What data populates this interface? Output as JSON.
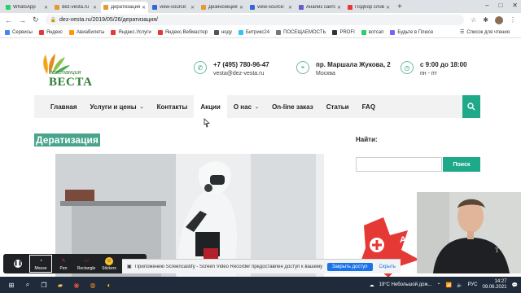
{
  "browser": {
    "tabs": [
      {
        "label": "WhatsApp",
        "color": "#25d366",
        "active": false
      },
      {
        "label": "dez-vesta.ru",
        "color": "#e59a2f",
        "active": false
      },
      {
        "label": "Дератизация",
        "color": "#e59a2f",
        "active": true
      },
      {
        "label": "view-source:",
        "color": "#3367d6",
        "active": false
      },
      {
        "label": "Дезинсекция",
        "color": "#e59a2f",
        "active": false
      },
      {
        "label": "view-source:",
        "color": "#3367d6",
        "active": false
      },
      {
        "label": "Анализ сайта",
        "color": "#6a5acd",
        "active": false
      },
      {
        "label": "Подбор слов",
        "color": "#e53935",
        "active": false
      }
    ],
    "new_tab_icon": "+",
    "window_controls": [
      "–",
      "□",
      "✕"
    ],
    "url": "dez-vesta.ru/2019/05/26/дератизация/",
    "bookmarks": [
      {
        "label": "Сервисы",
        "color": "#4285f4"
      },
      {
        "label": "Яндекс",
        "color": "#e53935"
      },
      {
        "label": "Авиабилеты",
        "color": "#ff9800"
      },
      {
        "label": "Яндекс.Услуги",
        "color": "#e53935"
      },
      {
        "label": "Яндекс.Вебмастер",
        "color": "#e53935"
      },
      {
        "label": "ноду",
        "color": "#555555"
      },
      {
        "label": "Битрикс24",
        "color": "#2fc6f6"
      },
      {
        "label": "ПОСЕЩАЕМОСТЬ",
        "color": "#777777"
      },
      {
        "label": "PROFI",
        "color": "#333333"
      },
      {
        "label": "вотсап",
        "color": "#25d366"
      },
      {
        "label": "Будьте в Плюсе",
        "color": "#7b61ff"
      }
    ],
    "reading_list": "Список для чтения"
  },
  "site": {
    "logo_top": "дезстанция",
    "logo_main": "ВЕСТА",
    "phone": "+7 (495) 780-96-47",
    "email": "vesta@dez-vesta.ru",
    "address": "пр. Маршала Жукова, 2",
    "city": "Москва",
    "hours": "с 9:00 до 18:00",
    "days": "пн - пт",
    "nav": [
      {
        "label": "Главная",
        "dropdown": false,
        "active": false
      },
      {
        "label": "Услуги и цены",
        "dropdown": true,
        "active": false
      },
      {
        "label": "Контакты",
        "dropdown": false,
        "active": false
      },
      {
        "label": "Акции",
        "dropdown": false,
        "active": true
      },
      {
        "label": "О нас",
        "dropdown": true,
        "active": false
      },
      {
        "label": "On-line заказ",
        "dropdown": false,
        "active": false
      },
      {
        "label": "Статьи",
        "dropdown": false,
        "active": false
      },
      {
        "label": "FAQ",
        "dropdown": false,
        "active": false
      }
    ],
    "page_title": "Дератизация",
    "sidebar_search_label": "Найти:",
    "sidebar_search_placeholder": "",
    "sidebar_search_button": "Поиск",
    "ad_text": "АК",
    "accent_color": "#1ea98a"
  },
  "screencastify": {
    "tools": [
      {
        "label": "",
        "icon": "pause-icon",
        "color": "#ffffff"
      },
      {
        "label": "Mouse",
        "icon": "cursor-icon",
        "color": "#ffffff"
      },
      {
        "label": "Pen",
        "icon": "pen-icon",
        "color": "#e53935"
      },
      {
        "label": "Rectangle",
        "icon": "rectangle-icon",
        "color": "#e53935"
      },
      {
        "label": "Stickers",
        "icon": "sticker-icon",
        "color": "#fbc02d"
      },
      {
        "label": "",
        "icon": "eraser-icon",
        "color": "#ffffff"
      }
    ],
    "share_text": "Приложению Screencastify - Screen Video Recorder предоставлен доступ к вашему экрану.",
    "stop_label": "Закрыть доступ",
    "hide_label": "Скрыть"
  },
  "taskbar": {
    "weather": "19°C  Небольшой дож...",
    "lang": "РУС",
    "time": "14:27",
    "date": "09.06.2021"
  }
}
